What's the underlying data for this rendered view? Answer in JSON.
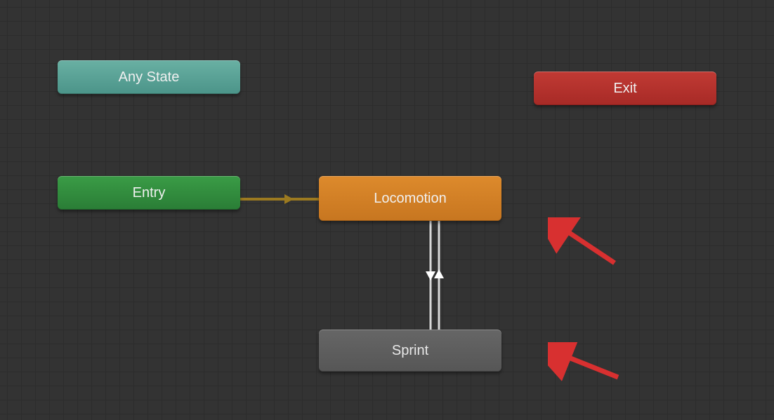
{
  "nodes": {
    "anyState": {
      "label": "Any State"
    },
    "exit": {
      "label": "Exit"
    },
    "entry": {
      "label": "Entry"
    },
    "locomotion": {
      "label": "Locomotion"
    },
    "sprint": {
      "label": "Sprint"
    }
  },
  "transitions": {
    "entryToLocomotion": {
      "from": "entry",
      "to": "locomotion"
    },
    "locomotionSprint": {
      "from": "locomotion",
      "to": "sprint",
      "bidirectional": true
    }
  },
  "colors": {
    "anyState": "#5aa397",
    "exit": "#b4322d",
    "entry": "#328c3e",
    "default": "#d28326",
    "normal": "#5e5e5e",
    "transition": "#9c7a20",
    "bidirectional": "#d8d8d8",
    "annotation": "#d83030"
  }
}
